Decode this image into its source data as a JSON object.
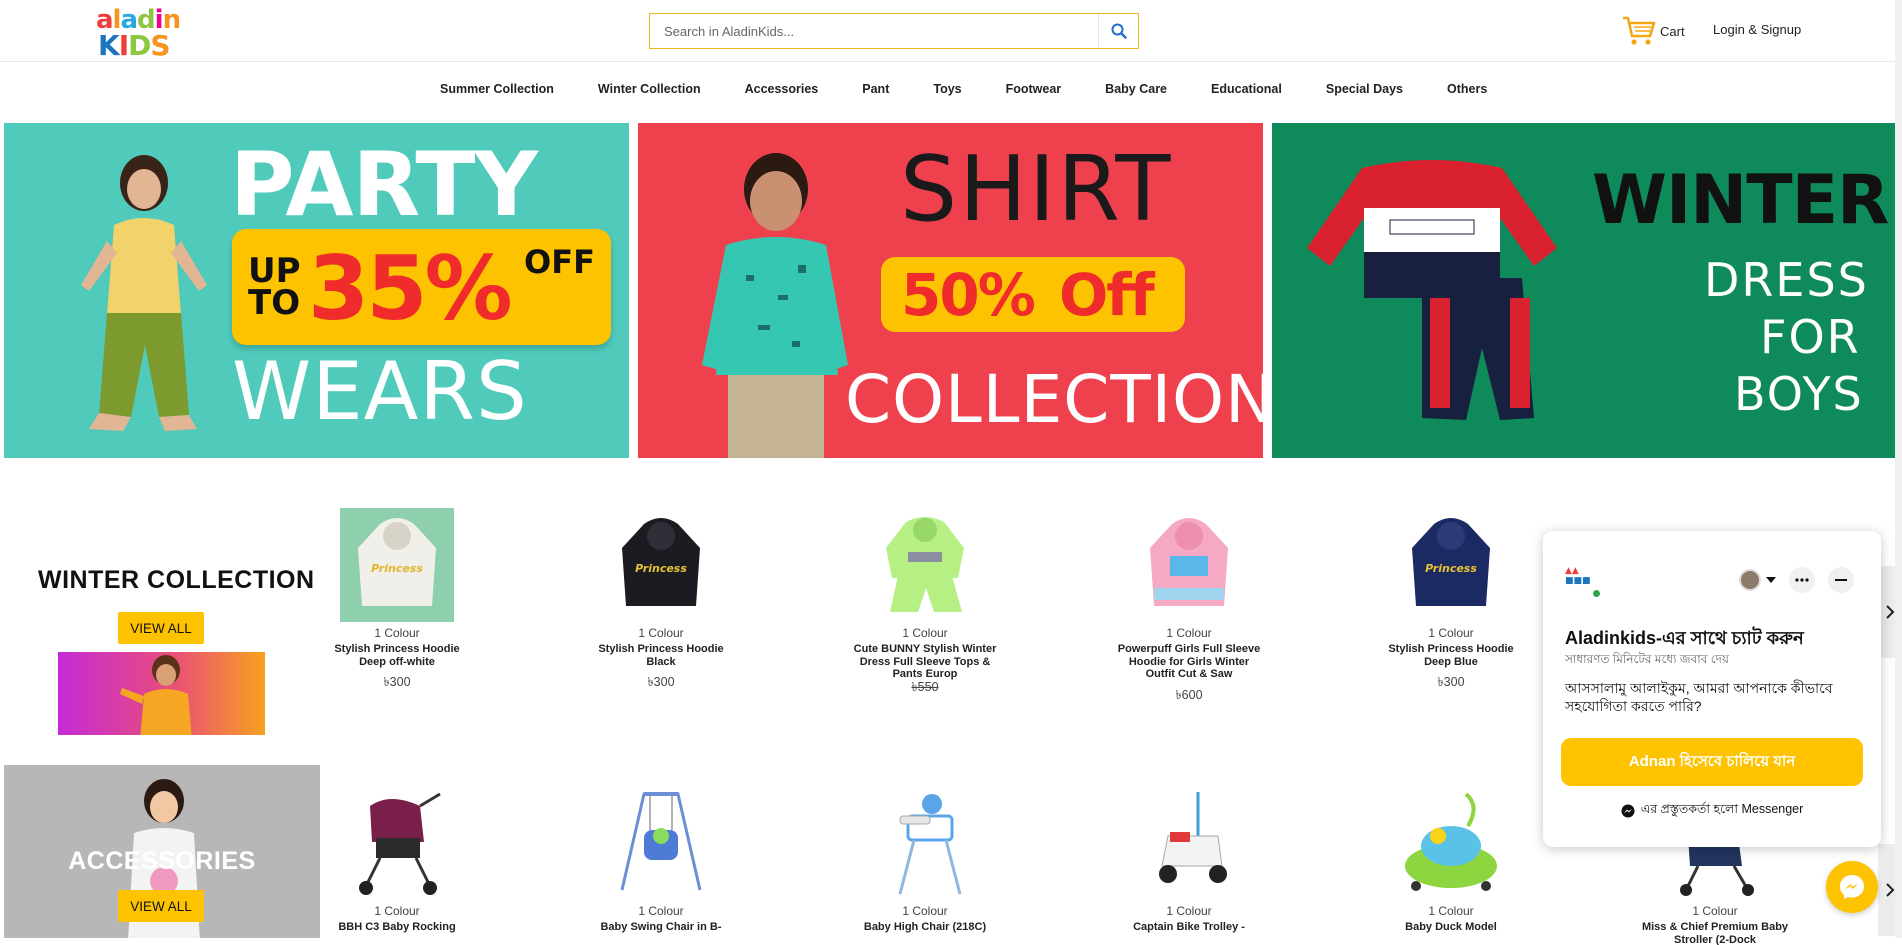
{
  "logo": {
    "line1": "aladin",
    "line2": "KIDS"
  },
  "search": {
    "placeholder": "Search in AladinKids..."
  },
  "header": {
    "cart_label": "Cart",
    "login_label": "Login & Signup"
  },
  "nav": {
    "items": [
      "Summer Collection",
      "Winter Collection",
      "Accessories",
      "Pant",
      "Toys",
      "Footwear",
      "Baby Care",
      "Educational",
      "Special Days",
      "Others"
    ]
  },
  "banners": [
    {
      "line1": "PARTY",
      "up": "UP",
      "to": "TO",
      "percent": "35%",
      "off": "OFF",
      "line3": "WEARS",
      "bg": "#4fcabb"
    },
    {
      "line1": "SHIRT",
      "percent": "50%",
      "off": "Off",
      "line3": "COLLECTION",
      "bg": "#ef404e"
    },
    {
      "line1": "WINTER",
      "line2": "DRESS",
      "line3": "FOR",
      "line4": "BOYS",
      "bg": "#0e8a5b"
    }
  ],
  "winter": {
    "title": "WINTER COLLECTION",
    "view_all": "VIEW ALL",
    "products": [
      {
        "colour": "1 Colour",
        "name": "Stylish Princess Hoodie Deep off-white",
        "price": "৳300"
      },
      {
        "colour": "1 Colour",
        "name": "Stylish Princess Hoodie Black",
        "price": "৳300"
      },
      {
        "colour": "1 Colour",
        "name": "Cute BUNNY Stylish Winter Dress Full Sleeve Tops & Pants Europ",
        "price": "৳550"
      },
      {
        "colour": "1 Colour",
        "name": "Powerpuff Girls Full Sleeve Hoodie for Girls Winter Outfit Cut & Saw",
        "price": "৳600"
      },
      {
        "colour": "1 Colour",
        "name": "Stylish Princess Hoodie Deep Blue",
        "price": "৳300"
      }
    ]
  },
  "accessories": {
    "title": "ACCESSORIES",
    "view_all": "VIEW ALL",
    "products": [
      {
        "colour": "1 Colour",
        "name": "BBH C3 Baby Rocking"
      },
      {
        "colour": "1 Colour",
        "name": "Baby Swing Chair in B-"
      },
      {
        "colour": "1 Colour",
        "name": "Baby High Chair (218C)"
      },
      {
        "colour": "1 Colour",
        "name": "Captain Bike Trolley -"
      },
      {
        "colour": "1 Colour",
        "name": "Baby Duck Model"
      },
      {
        "colour": "1 Colour",
        "name": "Miss & Chief Premium Baby Stroller (2-Dock"
      }
    ]
  },
  "chat": {
    "title": "Aladinkids-এর সাথে চ্যাট করুন",
    "subtitle": "সাধারণত মিনিটের মধ্যে জবাব দেয়",
    "message": "আসসালামু আলাইকুম, আমরা আপনাকে কীভাবে সহযোগিতা করতে পারি?",
    "button": "Adnan হিসেবে চালিয়ে যান",
    "powered": "এর প্রস্তুতকর্তা হলো Messenger"
  },
  "colors": {
    "accent": "#fdc300",
    "messenger_blue": "#0a7cff"
  }
}
